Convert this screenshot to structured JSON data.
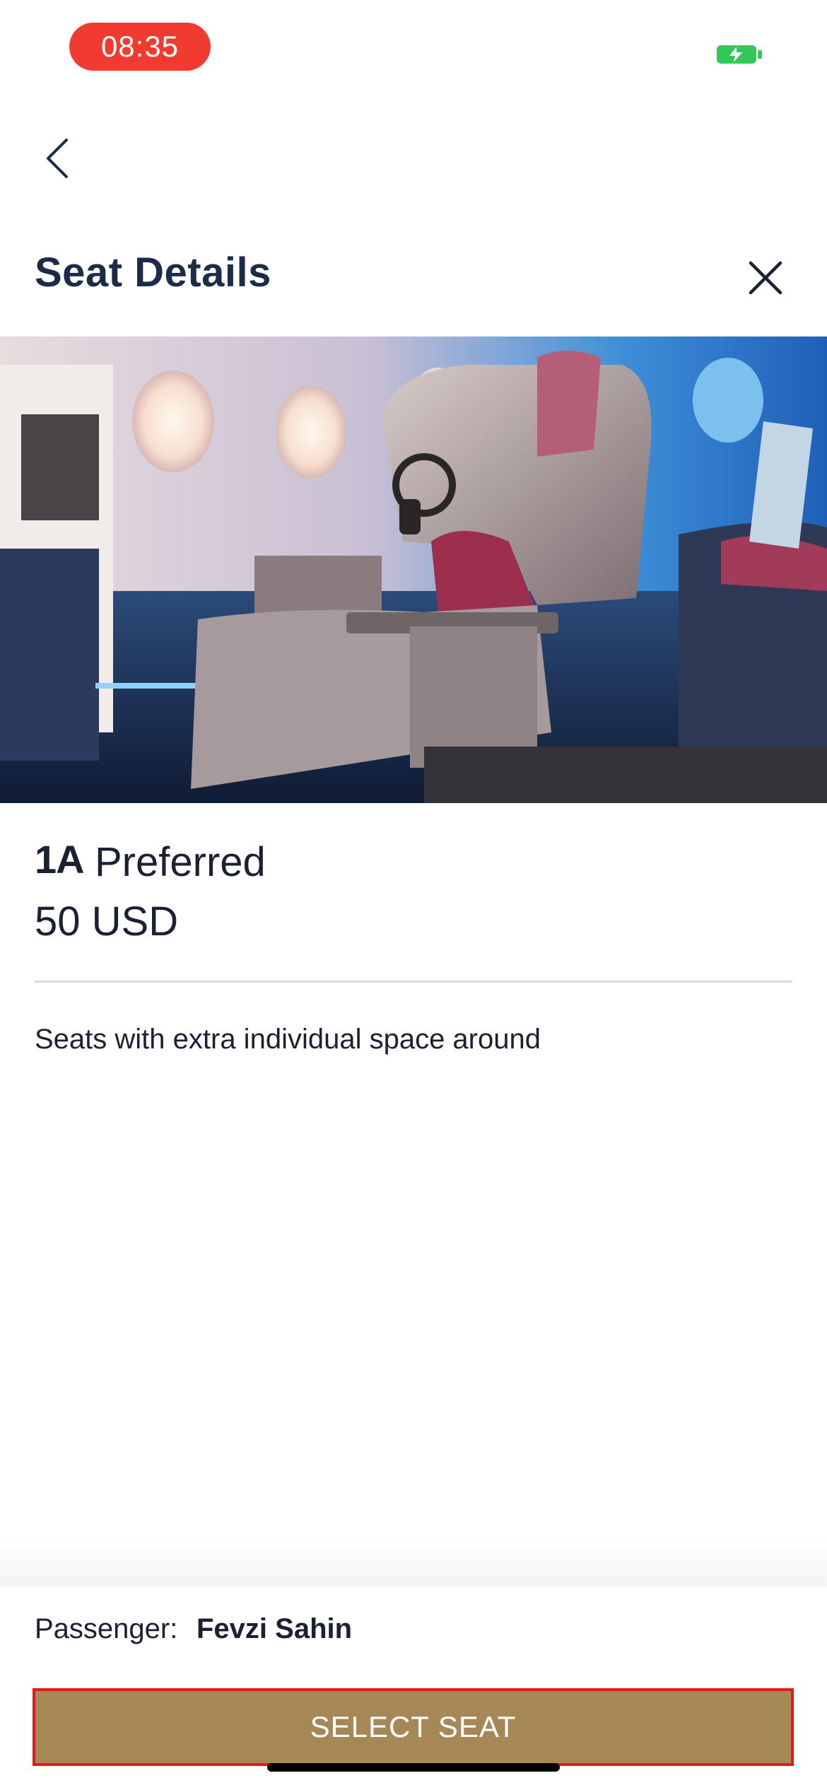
{
  "status_bar": {
    "time": "08:35",
    "time_pill_color": "#f13a30",
    "battery_icon": "battery-charging-icon",
    "battery_color": "#34c759"
  },
  "header": {
    "back_icon": "chevron-left-icon",
    "title": "Seat Details",
    "close_icon": "close-icon"
  },
  "seat": {
    "image": "business-class-seat-photo",
    "number": "1A",
    "type": "Preferred",
    "price": "50 USD",
    "description": "Seats with extra individual space around"
  },
  "footer": {
    "passenger_label": "Passenger:",
    "passenger_name": "Fevzi Sahin",
    "select_button_label": "SELECT SEAT",
    "button_color": "#a68756",
    "button_border_color": "#e11a1a"
  }
}
